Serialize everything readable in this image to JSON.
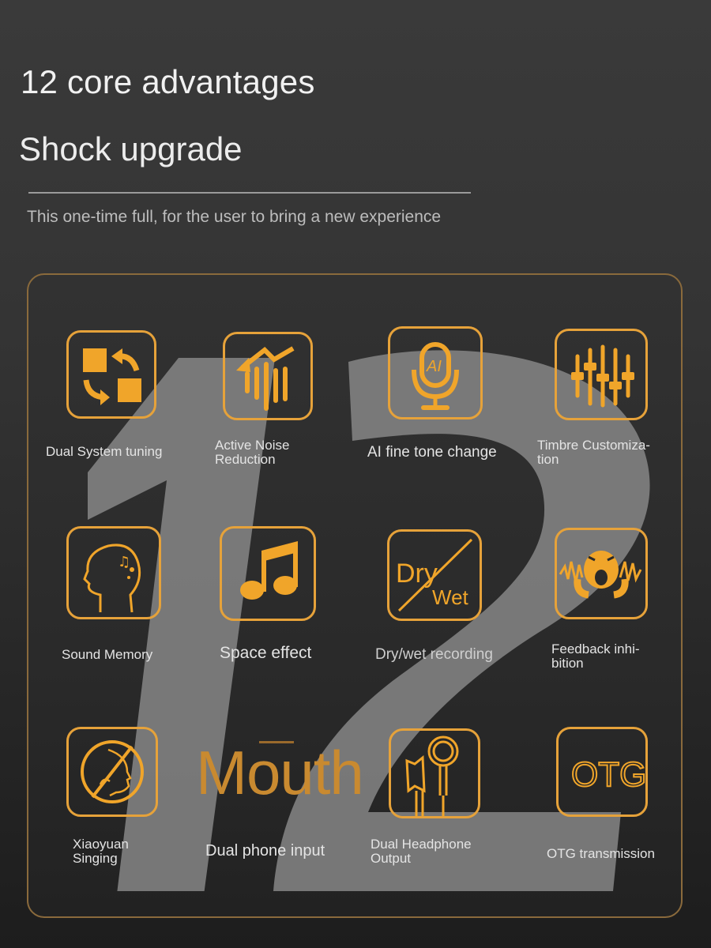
{
  "header": {
    "title": "12 core advantages",
    "subtitle_title": "Shock upgrade",
    "tagline": "This one-time full, for the user to bring a new experience"
  },
  "watermark": {
    "text": "12"
  },
  "accent_color": "#e6a23a",
  "features": [
    {
      "label": "Dual System tuning",
      "icon": "swap-squares-icon"
    },
    {
      "label": "Active Noise Reduction",
      "label_lines": [
        "Active Noise",
        "Reduction"
      ],
      "icon": "noise-reduction-icon"
    },
    {
      "label": "AI fine tone change",
      "icon": "ai-microphone-icon"
    },
    {
      "label": "Timbre Customiza-tion",
      "label_lines": [
        "Timbre Customiza-",
        "tion"
      ],
      "icon": "equalizer-sliders-icon"
    },
    {
      "label": "Sound Memory",
      "icon": "head-music-icon"
    },
    {
      "label": "Space effect",
      "icon": "music-note-icon"
    },
    {
      "label": "Dry/wet recording",
      "icon": "dry-wet-icon",
      "icon_text": {
        "dry": "Dry",
        "wet": "Wet"
      }
    },
    {
      "label": "Feedback inhi-bition",
      "label_lines": [
        "Feedback inhi-",
        "bition"
      ],
      "icon": "feedback-scream-icon"
    },
    {
      "label": "Xiaoyuan Singing",
      "label_lines": [
        "Xiaoyuan",
        "Singing"
      ],
      "icon": "no-singing-icon"
    },
    {
      "label": "Dual phone input",
      "icon": "mouth-text-icon",
      "icon_text": "Mouth"
    },
    {
      "label": "Dual Headphone Output",
      "label_lines": [
        "Dual Headphone",
        "Output"
      ],
      "icon": "earphone-icon"
    },
    {
      "label": "OTG transmission",
      "icon": "otg-icon",
      "icon_text": "OTG"
    }
  ]
}
